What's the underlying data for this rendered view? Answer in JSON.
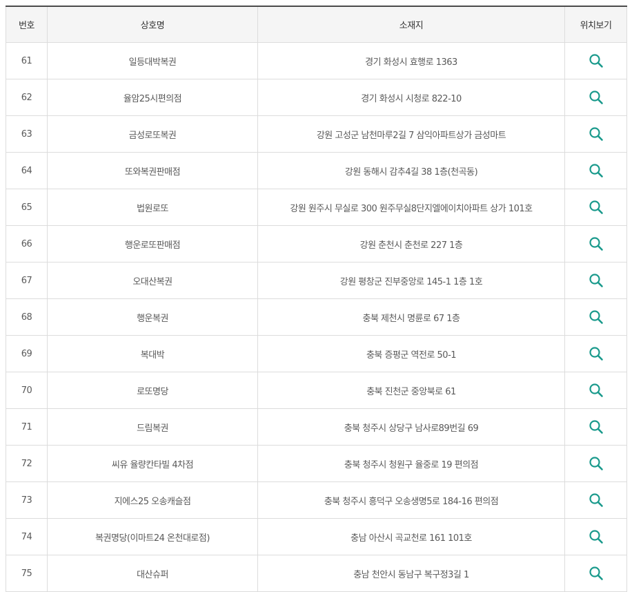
{
  "table": {
    "headers": {
      "no": "번호",
      "name": "상호명",
      "address": "소재지",
      "map": "위치보기"
    },
    "rows": [
      {
        "no": "61",
        "name": "일등대박복권",
        "address": "경기 화성시 효행로 1363"
      },
      {
        "no": "62",
        "name": "율암25시편의점",
        "address": "경기 화성시 시청로 822-10"
      },
      {
        "no": "63",
        "name": "금성로또복권",
        "address": "강원 고성군 남천마루2길 7 삼익아파트상가 금성마트"
      },
      {
        "no": "64",
        "name": "또와복권판매점",
        "address": "강원 동해시 감추4길 38 1층(천곡동)"
      },
      {
        "no": "65",
        "name": "법원로또",
        "address": "강원 원주시 무실로 300 원주무실8단지엘에이치아파트 상가 101호"
      },
      {
        "no": "66",
        "name": "행운로또판매점",
        "address": "강원 춘천시 춘천로 227 1층"
      },
      {
        "no": "67",
        "name": "오대산복권",
        "address": "강원 평창군 진부중앙로 145-1 1층 1호"
      },
      {
        "no": "68",
        "name": "행운복권",
        "address": "충북 제천시 명륜로 67 1층"
      },
      {
        "no": "69",
        "name": "복대박",
        "address": "충북 증평군 역전로 50-1"
      },
      {
        "no": "70",
        "name": "로또명당",
        "address": "충북 진천군 중앙북로 61"
      },
      {
        "no": "71",
        "name": "드림복권",
        "address": "충북 청주시 상당구 남사로89번길 69"
      },
      {
        "no": "72",
        "name": "씨유 율량칸타빌 4차점",
        "address": "충북 청주시 청원구 율중로 19 편의점"
      },
      {
        "no": "73",
        "name": "지에스25 오송캐슬점",
        "address": "충북 청주시 흥덕구 오송생명5로 184-16 편의점"
      },
      {
        "no": "74",
        "name": "복권명당(이마트24 온천대로점)",
        "address": "충남 아산시 곡교천로 161 101호"
      },
      {
        "no": "75",
        "name": "대산슈퍼",
        "address": "충남 천안시 동남구 복구정3길 1"
      }
    ]
  },
  "icons": {
    "map": "search-icon"
  },
  "colors": {
    "icon": "#1a9a8c",
    "header_bg": "#f5f5f5",
    "top_border": "#4a4a4a",
    "grid": "#dcdcdc"
  }
}
